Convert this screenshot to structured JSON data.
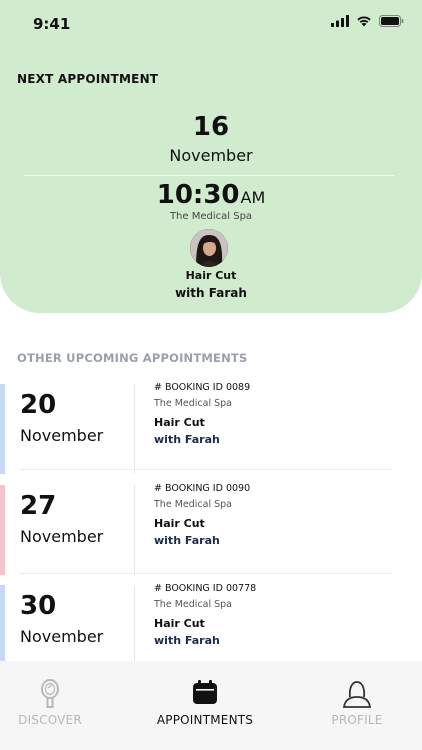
{
  "status_bar": {
    "time": "9:41"
  },
  "next_appointment": {
    "heading": "NEXT APPOINTMENT",
    "day": "16",
    "month": "November",
    "time": "10:30",
    "ampm": "AM",
    "place": "The Medical Spa",
    "service": "Hair Cut",
    "stylist": "with Farah"
  },
  "upcoming": {
    "heading": "OTHER UPCOMING APPOINTMENTS",
    "items": [
      {
        "day": "20",
        "month": "November",
        "booking": "# BOOKING ID 0089",
        "place": "The Medical Spa",
        "service": "Hair Cut",
        "stylist": "with Farah",
        "accent": "#c9d9f5"
      },
      {
        "day": "27",
        "month": "November",
        "booking": "# BOOKING ID 0090",
        "place": "The Medical Spa",
        "service": "Hair Cut",
        "stylist": "with Farah",
        "accent": "#f3c4cb"
      },
      {
        "day": "30",
        "month": "November",
        "booking": "# BOOKING ID 00778",
        "place": "The Medical Spa",
        "service": "Hair Cut",
        "stylist": "with Farah",
        "accent": "#c9d9f5"
      }
    ]
  },
  "tabs": [
    {
      "label": "DISCOVER",
      "icon": "mirror-icon",
      "active": false
    },
    {
      "label": "APPOINTMENTS",
      "icon": "calendar-icon",
      "active": true
    },
    {
      "label": "PROFILE",
      "icon": "profile-icon",
      "active": false
    }
  ],
  "colors": {
    "card_background": "#d1ebcf",
    "tab_bar_background": "#f6f6f7",
    "muted_heading": "#9aa0ab",
    "stylist_text": "#1d2b4d"
  }
}
